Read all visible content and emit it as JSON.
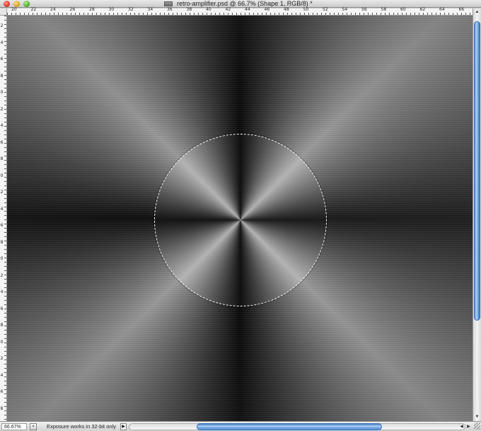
{
  "window": {
    "title": "retro-amplifier.psd @ 66.7% (Shape 1, RGB/8) *"
  },
  "ruler": {
    "top_labels": [
      "20",
      "22",
      "24",
      "26",
      "28",
      "30",
      "32",
      "34",
      "36",
      "38",
      "40",
      "42",
      "44",
      "46",
      "48",
      "50",
      "52",
      "54",
      "56",
      "58",
      "60",
      "62",
      "64",
      "66"
    ],
    "left_labels": [
      "2",
      "4",
      "6",
      "8",
      "10",
      "12",
      "14",
      "16",
      "18",
      "20",
      "22",
      "24",
      "26",
      "28",
      "30",
      "32",
      "34",
      "36",
      "38",
      "40",
      "42",
      "44",
      "46",
      "48",
      "50"
    ]
  },
  "statusbar": {
    "zoom": "66.67%",
    "message": "Exposure works in 32-bit only",
    "menu_arrow": "▶"
  },
  "scrollbar": {
    "up_arrow": "▲",
    "down_arrow": "▼",
    "left_arrow": "◀",
    "right_arrow": "▶"
  },
  "colors": {
    "accent": "#5b93d6",
    "canvas_dark": "#0a0a0a",
    "canvas_light": "#9a9a9a",
    "selection": "#ffffff"
  },
  "icons": {
    "close": "close-icon",
    "minimize": "minimize-icon",
    "zoom": "zoom-icon",
    "document": "document-icon"
  }
}
